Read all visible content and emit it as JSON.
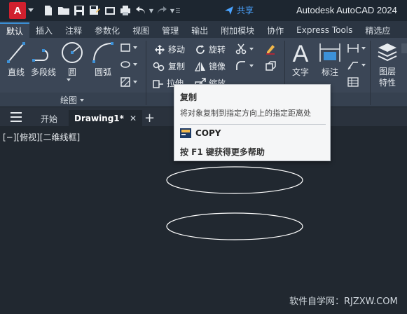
{
  "app": {
    "logo_letter": "A",
    "title": "Autodesk AutoCAD 2024",
    "share_label": "共享"
  },
  "ribbon_tabs": [
    {
      "label": "默认",
      "active": true
    },
    {
      "label": "插入"
    },
    {
      "label": "注释"
    },
    {
      "label": "参数化"
    },
    {
      "label": "视图"
    },
    {
      "label": "管理"
    },
    {
      "label": "输出"
    },
    {
      "label": "附加模块"
    },
    {
      "label": "协作"
    },
    {
      "label": "Express Tools"
    },
    {
      "label": "精选应"
    }
  ],
  "draw_panel": {
    "title": "绘图",
    "line": "直线",
    "polyline": "多段线",
    "circle": "圆",
    "arc": "圆弧"
  },
  "modify_panel": {
    "move": "移动",
    "rotate": "旋转",
    "copy": "复制",
    "mirror": "镜像",
    "stretch": "拉伸",
    "scale": "缩放"
  },
  "annotation_panel": {
    "text": "文字",
    "dimension": "标注"
  },
  "layers_panel": {
    "layer_props": "图层特性"
  },
  "doc_tabs": {
    "start": "开始",
    "drawing": "Drawing1*",
    "close": "✕",
    "add": "+"
  },
  "viewport_label": "[−][俯视][二维线框]",
  "tooltip": {
    "title": "复制",
    "description": "将对象复制到指定方向上的指定距离处",
    "command": "COPY",
    "help": "按 F1 键获得更多帮助"
  },
  "watermark": "软件自学网：RJZXW.COM",
  "colors": {
    "canvas": "#212830",
    "ribbon": "#3b4656",
    "accent": "#3c91d8",
    "logo": "#d1202e",
    "share": "#4aa3ff"
  }
}
